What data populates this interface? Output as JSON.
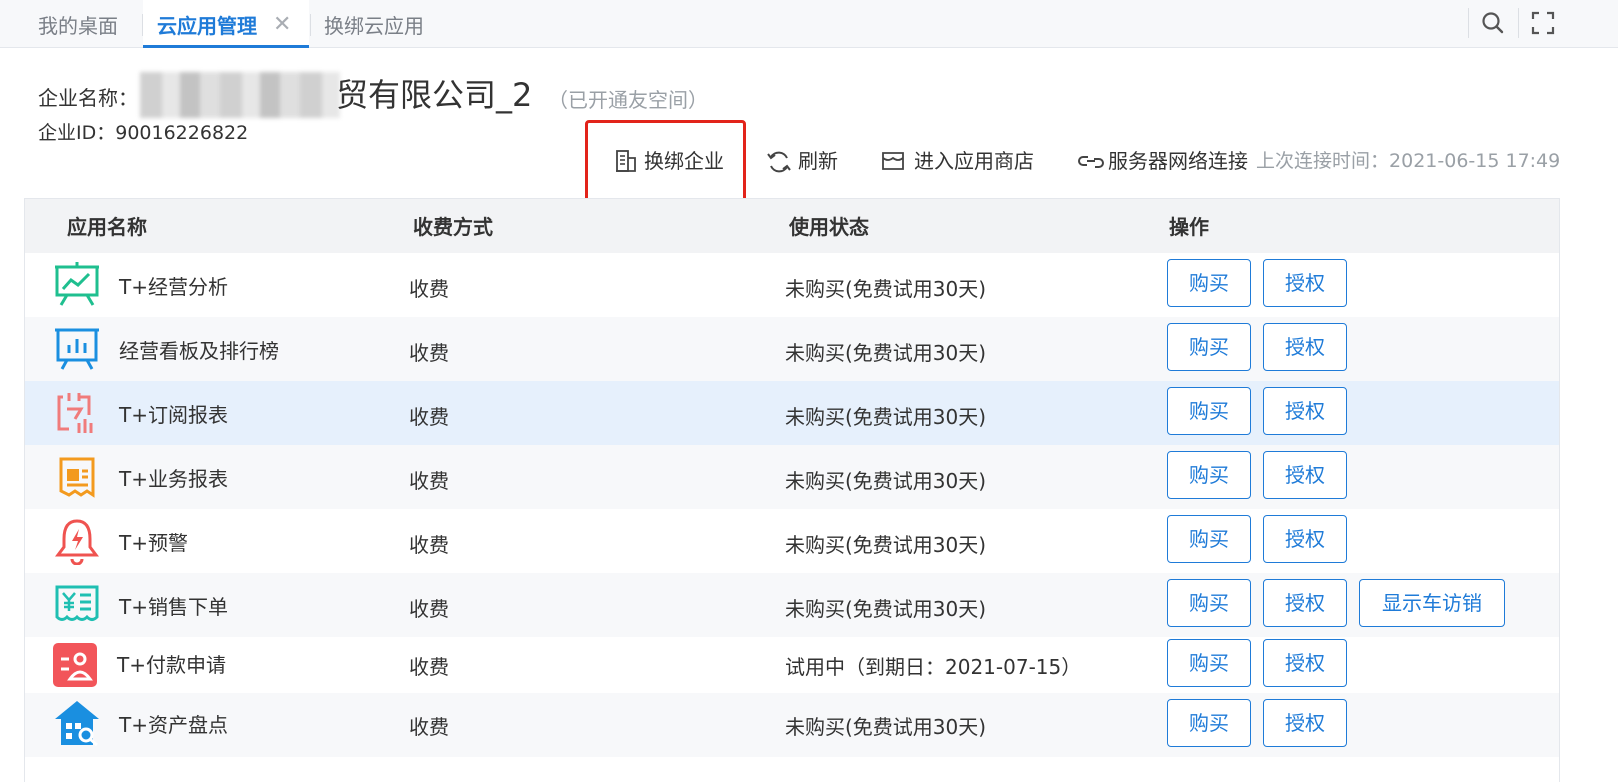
{
  "tabs": [
    {
      "label": "我的桌面",
      "active": false
    },
    {
      "label": "云应用管理",
      "active": true
    },
    {
      "label": "换绑云应用",
      "active": false
    }
  ],
  "tab_close_glyph": "✕",
  "topbar_icons": [
    "search-icon",
    "fullscreen-icon"
  ],
  "enterprise": {
    "name_label": "企业名称：",
    "name_visible": "贸有限公司_2",
    "space_note": "（已开通友空间）",
    "id_label": "企业ID：",
    "id_value": "90016226822"
  },
  "toolbar": {
    "rebind_label": "换绑企业",
    "refresh_label": "刷新",
    "store_label": "进入应用商店",
    "network_label": "服务器网络连接",
    "last_connect_label": "上次连接时间：",
    "last_connect_time": "2021-06-15 17:49"
  },
  "table": {
    "headers": {
      "name": "应用名称",
      "charge": "收费方式",
      "status": "使用状态",
      "ops": "操作"
    },
    "buy_label": "购买",
    "auth_label": "授权",
    "rows": [
      {
        "icon": "chart-board-icon",
        "name": "T+经营分析",
        "charge": "收费",
        "status": "未购买(免费试用30天)",
        "extra": ""
      },
      {
        "icon": "dashboard-ranking-icon",
        "name": "经营看板及排行榜",
        "charge": "收费",
        "status": "未购买(免费试用30天)",
        "extra": ""
      },
      {
        "icon": "subscribe-report-icon",
        "name": "T+订阅报表",
        "charge": "收费",
        "status": "未购买(免费试用30天)",
        "extra": ""
      },
      {
        "icon": "business-report-icon",
        "name": "T+业务报表",
        "charge": "收费",
        "status": "未购买(免费试用30天)",
        "extra": ""
      },
      {
        "icon": "alarm-bell-icon",
        "name": "T+预警",
        "charge": "收费",
        "status": "未购买(免费试用30天)",
        "extra": ""
      },
      {
        "icon": "sales-order-icon",
        "name": "T+销售下单",
        "charge": "收费",
        "status": "未购买(免费试用30天)",
        "extra": "显示车访销"
      },
      {
        "icon": "payment-request-icon",
        "name": "T+付款申请",
        "charge": "收费",
        "status": "试用中（到期日：2021-07-15）",
        "extra": ""
      },
      {
        "icon": "asset-inventory-icon",
        "name": "T+资产盘点",
        "charge": "收费",
        "status": "未购买(免费试用30天)",
        "extra": ""
      }
    ]
  },
  "colors": {
    "accent": "#1f7bd8",
    "highlight_border": "#e2231a",
    "row_highlight": "#e6f0fc"
  }
}
